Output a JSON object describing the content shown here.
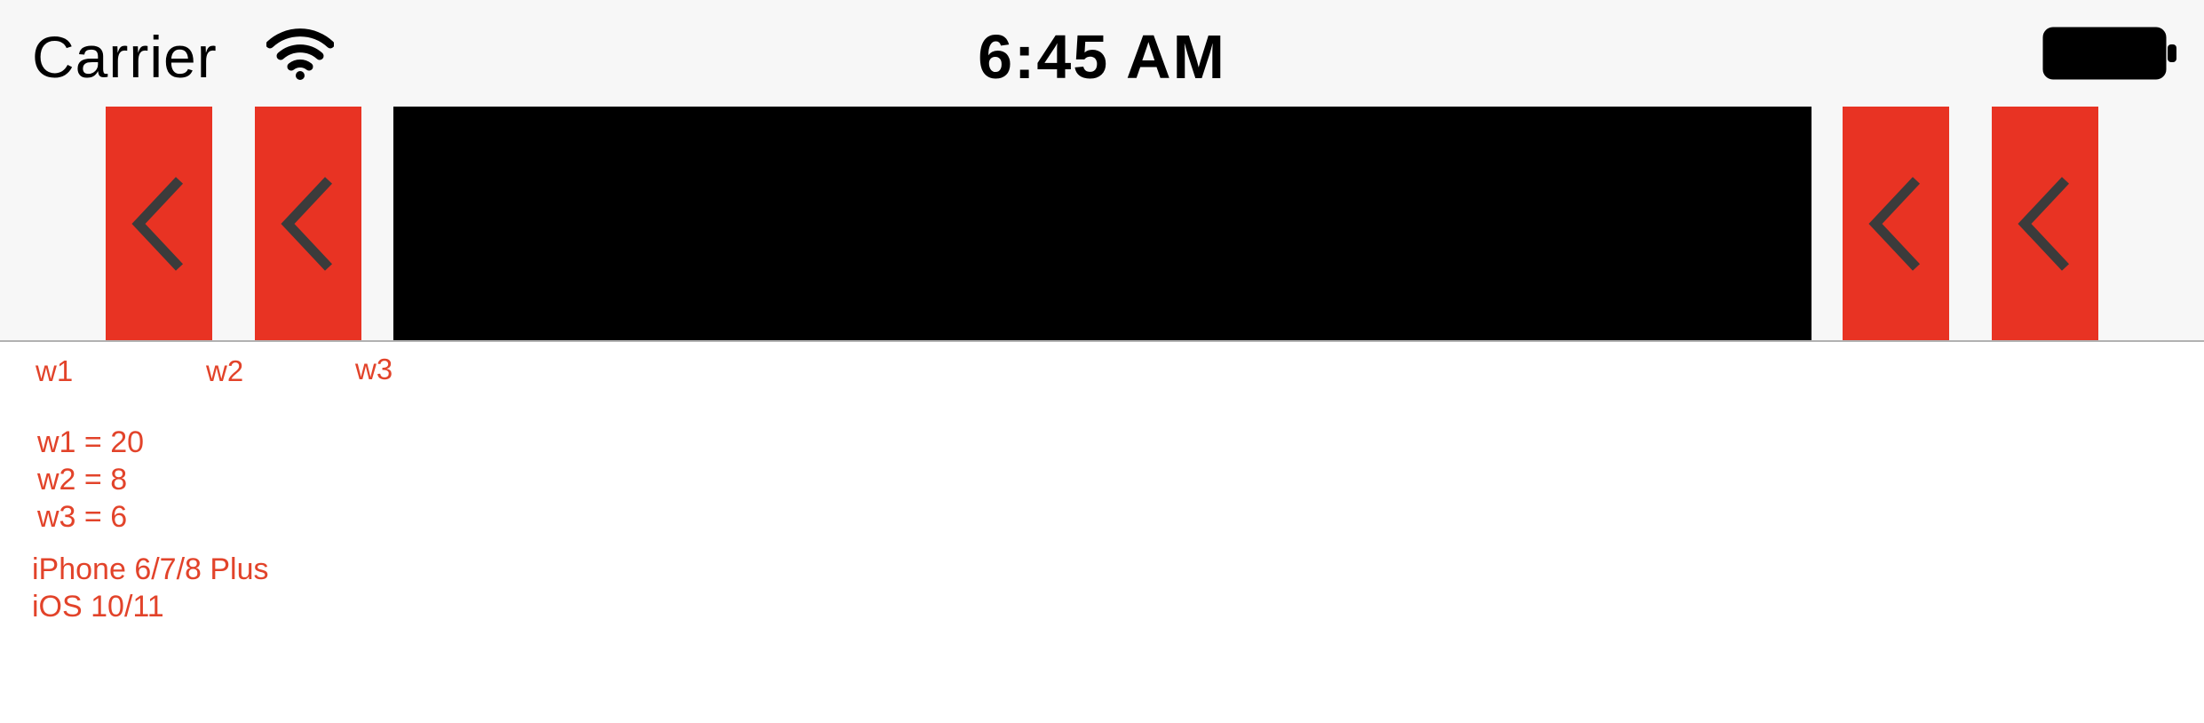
{
  "status_bar": {
    "carrier": "Carrier",
    "time": "6:45 AM"
  },
  "nav_bar": {
    "left_buttons": [
      {
        "icon": "chevron-left-icon",
        "color": "#e83323"
      },
      {
        "icon": "chevron-left-icon",
        "color": "#e83323"
      }
    ],
    "right_buttons": [
      {
        "icon": "chevron-left-icon",
        "color": "#e83323"
      },
      {
        "icon": "chevron-left-icon",
        "color": "#e83323"
      }
    ],
    "title_view_color": "#000000"
  },
  "labels": {
    "w1": "w1",
    "w2": "w2",
    "w3": "w3"
  },
  "notes": {
    "line1": "w1 = 20",
    "line2": "w2 = 8",
    "line3": "w3 = 6",
    "device": "iPhone 6/7/8 Plus",
    "os": "iOS 10/11"
  },
  "colors": {
    "accent": "#e83323",
    "label_text": "#e2432a",
    "bar_background": "#f7f7f7"
  }
}
